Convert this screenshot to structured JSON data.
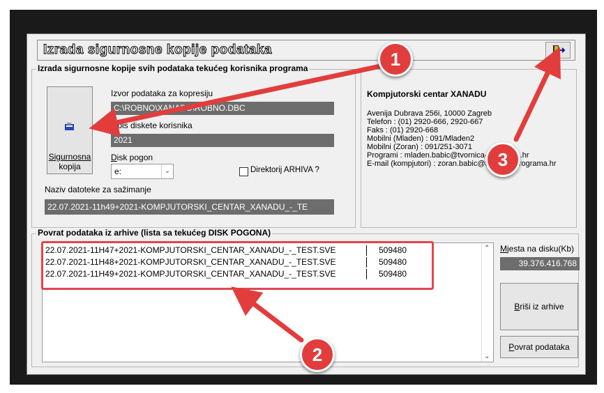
{
  "window": {
    "title": "Izrada sigurnosne kopije podataka"
  },
  "backup": {
    "group_label": "Izrada sigurnosne kopije svih podataka tekućeg korisnika programa",
    "button_line1": "Sigurnosna",
    "button_line2": "kopija",
    "source_label": "Izvor podataka za kopresiju",
    "source_value": "C:\\ROBNO\\XANADU\\ROBNO.DBC",
    "disk_label": "Opis diskete korisnika",
    "disk_value": "2021",
    "drive_label": "Disk pogon",
    "drive_value": "e:",
    "archive_checkbox_label": "Direktorij ARHIVA ?",
    "archive_checked": false,
    "filename_label": "Naziv datoteke za sažimanje",
    "filename_value": "22.07.2021-11h49+2021-KOMPJUTORSKI_CENTAR_XANADU_-_TE"
  },
  "company": {
    "name": "Kompjutorski centar XANADU",
    "address": "Avenija Dubrava 256i, 10000 Zagreb",
    "phone": "Telefon : (01) 2920-666, 2920-667",
    "fax": "Faks : (01) 2920-668",
    "mobile1": "Mobilni (Mladen) : 091/Mladen2",
    "mobile2": "Mobilni (Zoran) : 091/251-3071",
    "programs": "Programi : mladen.babic@tvornica-programa.hr",
    "email": "E-mail (kompjutori) : zoran.babic@tvornica-programa.hr"
  },
  "restore": {
    "group_label": "Povrat podataka iz arhive (lista sa tekućeg DISK POGONA)",
    "files": [
      {
        "name": "22.07.2021-11H47+2021-KOMPJUTORSKI_CENTAR_XANADU_-_TEST.SVE",
        "size": "509480"
      },
      {
        "name": "22.07.2021-11H48+2021-KOMPJUTORSKI_CENTAR_XANADU_-_TEST.SVE",
        "size": "509480"
      },
      {
        "name": "22.07.2021-11H49+2021-KOMPJUTORSKI_CENTAR_XANADU_-_TEST.SVE",
        "size": "509480"
      }
    ],
    "space_label": "Mjesta na disku(Kb)",
    "space_value": "39.376.416.768",
    "delete_button": "Briši iz arhive",
    "restore_button": "Povrat podataka"
  },
  "annotations": {
    "badge1": "1",
    "badge2": "2",
    "badge3": "3",
    "color": "#e23d3d"
  }
}
